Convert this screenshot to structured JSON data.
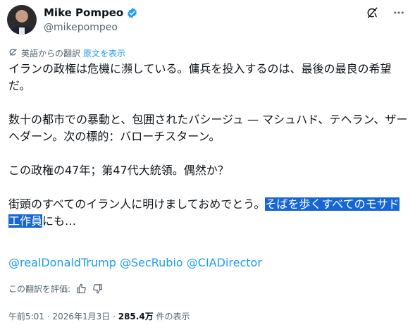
{
  "author": {
    "name": "Mike Pompeo",
    "handle": "@mikepompeo",
    "verified_color": "#1d9bf0"
  },
  "translation": {
    "label": "英語からの翻訳",
    "show_original": "原文を表示"
  },
  "tweet": {
    "p1": "イランの政権は危機に瀕している。傭兵を投入するのは、最後の最良の希望だ。",
    "p2": "数十の都市での暴動と、包囲されたバシージュ — マシュハド、テヘラン、ザーヘダーン。次の標的：バローチスターン。",
    "p3": "この政権の47年；第47代大統領。偶然か？",
    "p4_plain": "街頭のすべてのイラン人に明けましておめでとう。",
    "p4_selected": "そばを歩くすべてのモサド工作員",
    "p4_tail": "にも…"
  },
  "mentions": [
    "@realDonaldTrump",
    "@SecRubio",
    "@CIADirector"
  ],
  "rating": {
    "label": "この翻訳を評価:"
  },
  "meta": {
    "time": "午前5:01",
    "date": "2026年1月3日",
    "separator": "·",
    "views_count": "285.4万",
    "views_label": "件の表示"
  },
  "colors": {
    "accent": "#1d9bf0",
    "selection": "#1766d6",
    "secondary_text": "#536471"
  }
}
